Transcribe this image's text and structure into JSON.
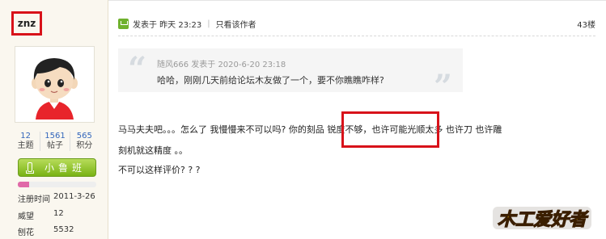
{
  "user": {
    "name": "znz",
    "stats": [
      {
        "value": "12",
        "label": "主题"
      },
      {
        "value": "1561",
        "label": "帖子"
      },
      {
        "value": "565",
        "label": "积分"
      }
    ],
    "rank": "小鲁班",
    "rank_progress": 0.14,
    "info": [
      {
        "key": "注册时间",
        "value": "2011-3-26"
      },
      {
        "key": "威望",
        "value": "12"
      },
      {
        "key": "刨花",
        "value": "5532"
      }
    ]
  },
  "post": {
    "posted": "发表于 昨天 23:23",
    "separator": "|",
    "view_author": "只看该作者",
    "floor": "43楼",
    "quote": {
      "meta": "随风666 发表于 2020-6-20 23:18",
      "text": "哈哈，刚刚几天前给论坛木友做了一个，要不你瞧瞧咋样?"
    },
    "body": [
      "马马夫夫吧。。。怎么了   我慢慢来不可以吗?    你的刻品 锐度不够，也许可能光顺太多  也许刀  也许雕",
      "刻机就这精度  。。",
      "不可以这样评价? ? ?"
    ]
  },
  "watermark": "木工爱好者",
  "colors": {
    "highlight": "#d8121a",
    "rank_green": "#78b214",
    "link_blue": "#3366bb",
    "sidebar_bg": "#faf7ef"
  }
}
